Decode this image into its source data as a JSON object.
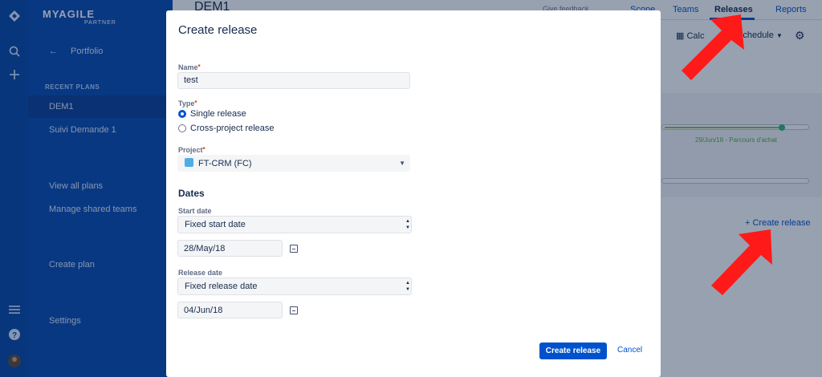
{
  "sidebar": {
    "logo_text": "MYAGILE",
    "logo_sub": "PARTNER",
    "back_label": "Portfolio",
    "recent_heading": "RECENT PLANS",
    "recent_plans": [
      "DEM1",
      "Suivi Demande 1"
    ],
    "links": [
      "View all plans",
      "Manage shared teams"
    ],
    "create_plan": "Create plan",
    "settings": "Settings"
  },
  "header": {
    "plan_title": "DEM1",
    "feedback": "Give feedback",
    "tabs": [
      "Scope",
      "Teams",
      "Releases",
      "Reports"
    ],
    "active_tab": "Releases",
    "toolbar": [
      "Calc",
      "Schedule"
    ]
  },
  "background": {
    "date_label": "29/Jun/18 - Parcours d'achat",
    "create_release_link": "+ Create release"
  },
  "modal": {
    "title": "Create release",
    "name_label": "Name",
    "name_value": "test",
    "type_label": "Type",
    "type_options": [
      "Single release",
      "Cross-project release"
    ],
    "type_selected": 0,
    "project_label": "Project",
    "project_value": "FT-CRM (FC)",
    "dates_heading": "Dates",
    "start_label": "Start date",
    "start_mode": "Fixed start date",
    "start_value": "28/May/18",
    "release_label": "Release date",
    "release_mode": "Fixed release date",
    "release_value": "04/Jun/18",
    "submit_label": "Create release",
    "cancel_label": "Cancel"
  },
  "colors": {
    "primary": "#0052cc",
    "sidebar": "#0a4ab0",
    "annotation_arrow": "#ff1a1a"
  }
}
